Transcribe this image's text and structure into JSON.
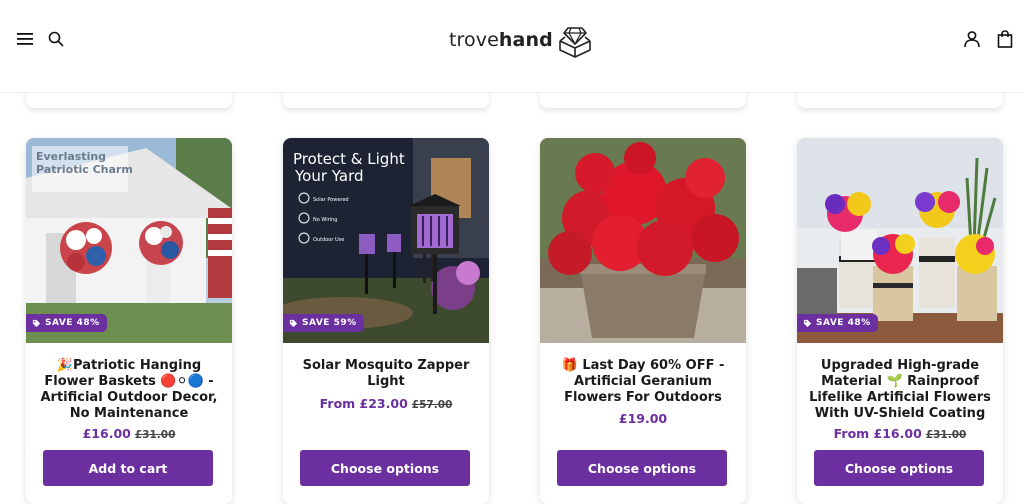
{
  "header": {
    "logo_light": "trove",
    "logo_bold": "hand"
  },
  "products": [
    {
      "emoji": "🎉",
      "title": "Patriotic Hanging Flower Baskets 🔴⚪🔵 - Artificial Outdoor Decor, No Maintenance",
      "price": "£16.00",
      "compare_price": "£31.00",
      "badge": "SAVE 48%",
      "button": "Add to cart",
      "image_overlay": {
        "heading_line1": "Everlasting",
        "heading_line2": "Patriotic Charm"
      }
    },
    {
      "emoji": "",
      "title": "Solar Mosquito Zapper Light",
      "price": "From £23.00",
      "compare_price": "£57.00",
      "badge": "SAVE 59%",
      "button": "Choose options",
      "image_overlay": {
        "heading_line1": "Protect & Light",
        "heading_line2": "Your Yard",
        "features": [
          "Solar Powered",
          "No Wiring",
          "Outdoor Use"
        ]
      }
    },
    {
      "emoji": "🎁",
      "title": "Last Day 60% OFF - Artificial Geranium Flowers For Outdoors",
      "price": "£19.00",
      "compare_price": "",
      "badge": "",
      "button": "Choose options"
    },
    {
      "emoji": "🌱",
      "title": "Upgraded High-grade Material 🌱 Rainproof Lifelike Artificial Flowers With UV-Shield Coating",
      "price": "From £16.00",
      "compare_price": "£31.00",
      "badge": "SAVE 48%",
      "button": "Choose options"
    }
  ],
  "colors": {
    "brand_purple": "#6b2fa0",
    "card_shadow": "rgba(0,0,0,0.12)"
  },
  "icons": [
    "menu-icon",
    "search-icon",
    "account-icon",
    "shopping-bag-icon",
    "diamond-box-icon",
    "tag-icon"
  ]
}
